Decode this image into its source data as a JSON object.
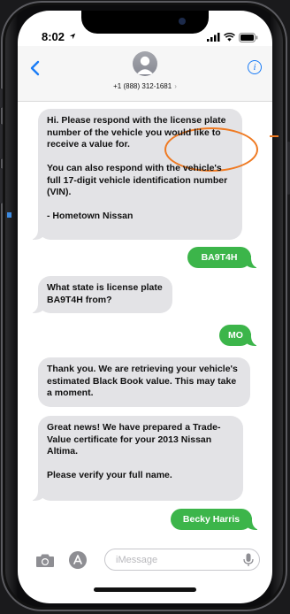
{
  "status_bar": {
    "time": "8:02",
    "icons": [
      "location-arrow-icon",
      "signal-bars-icon",
      "wifi-icon",
      "battery-icon"
    ]
  },
  "header": {
    "contact": "+1 (888) 312-1681",
    "info_label": "i",
    "back_icon": "chevron-left-icon"
  },
  "messages": [
    {
      "direction": "incoming",
      "text": "Hi. Please respond with the license plate number of the vehicle you would like to receive a value for.\n\nYou can also respond with the vehicle's full 17-digit vehicle identification number (VIN).\n\n- Hometown Nissan"
    },
    {
      "direction": "outgoing",
      "text": "BA9T4H"
    },
    {
      "direction": "incoming",
      "text": "What state is license plate BA9T4H from?"
    },
    {
      "direction": "outgoing",
      "text": "MO"
    },
    {
      "direction": "incoming",
      "text": "Thank you. We are retrieving your vehicle's estimated Black Book value. This may take a moment."
    },
    {
      "direction": "incoming",
      "text": "Great news! We have prepared a Trade-Value certificate for your 2013 Nissan Altima.\n\nPlease verify your full name."
    },
    {
      "direction": "outgoing",
      "text": "Becky Harris"
    }
  ],
  "composer": {
    "placeholder": "iMessage",
    "value": ""
  },
  "colors": {
    "outgoing_bubble": "#3cb54a",
    "incoming_bubble": "#e3e3e6",
    "ios_blue": "#1a7cf6",
    "highlight": "#ef7a22"
  }
}
